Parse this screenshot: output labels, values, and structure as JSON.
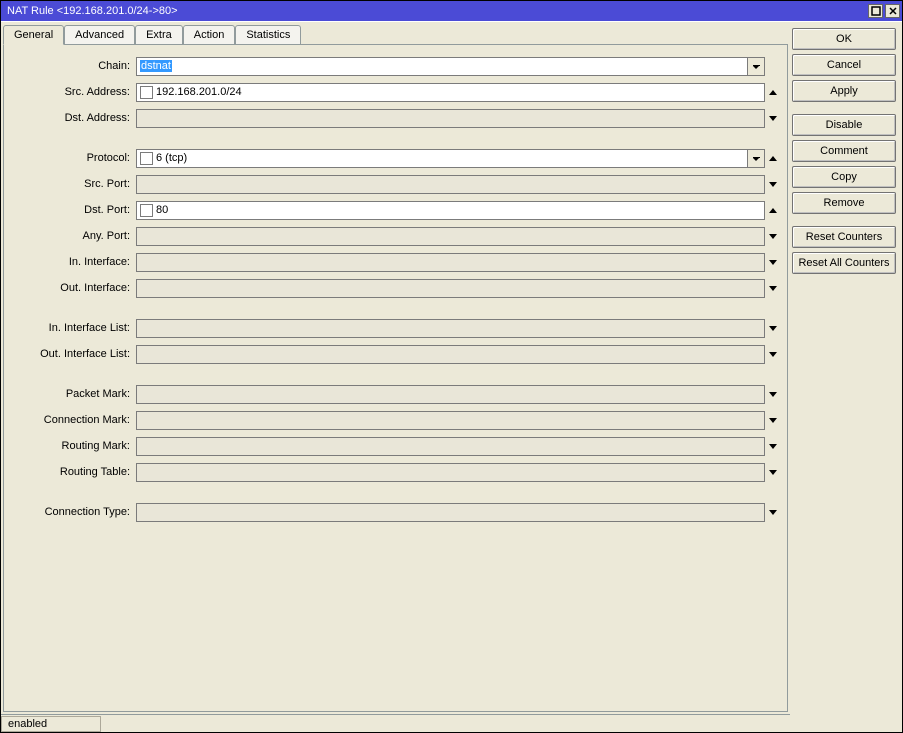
{
  "title": "NAT Rule <192.168.201.0/24->80>",
  "tabs": [
    "General",
    "Advanced",
    "Extra",
    "Action",
    "Statistics"
  ],
  "active_tab": 0,
  "buttons": {
    "ok": "OK",
    "cancel": "Cancel",
    "apply": "Apply",
    "disable": "Disable",
    "comment": "Comment",
    "copy": "Copy",
    "remove": "Remove",
    "reset_counters": "Reset Counters",
    "reset_all_counters": "Reset All Counters"
  },
  "labels": {
    "chain": "Chain:",
    "src_address": "Src. Address:",
    "dst_address": "Dst. Address:",
    "protocol": "Protocol:",
    "src_port": "Src. Port:",
    "dst_port": "Dst. Port:",
    "any_port": "Any. Port:",
    "in_interface": "In. Interface:",
    "out_interface": "Out. Interface:",
    "in_interface_list": "In. Interface List:",
    "out_interface_list": "Out. Interface List:",
    "packet_mark": "Packet Mark:",
    "connection_mark": "Connection Mark:",
    "routing_mark": "Routing Mark:",
    "routing_table": "Routing Table:",
    "connection_type": "Connection Type:"
  },
  "values": {
    "chain": "dstnat",
    "src_address": "192.168.201.0/24",
    "dst_address": "",
    "protocol": "6 (tcp)",
    "src_port": "",
    "dst_port": "80",
    "any_port": "",
    "in_interface": "",
    "out_interface": "",
    "in_interface_list": "",
    "out_interface_list": "",
    "packet_mark": "",
    "connection_mark": "",
    "routing_mark": "",
    "routing_table": "",
    "connection_type": ""
  },
  "status": "enabled"
}
